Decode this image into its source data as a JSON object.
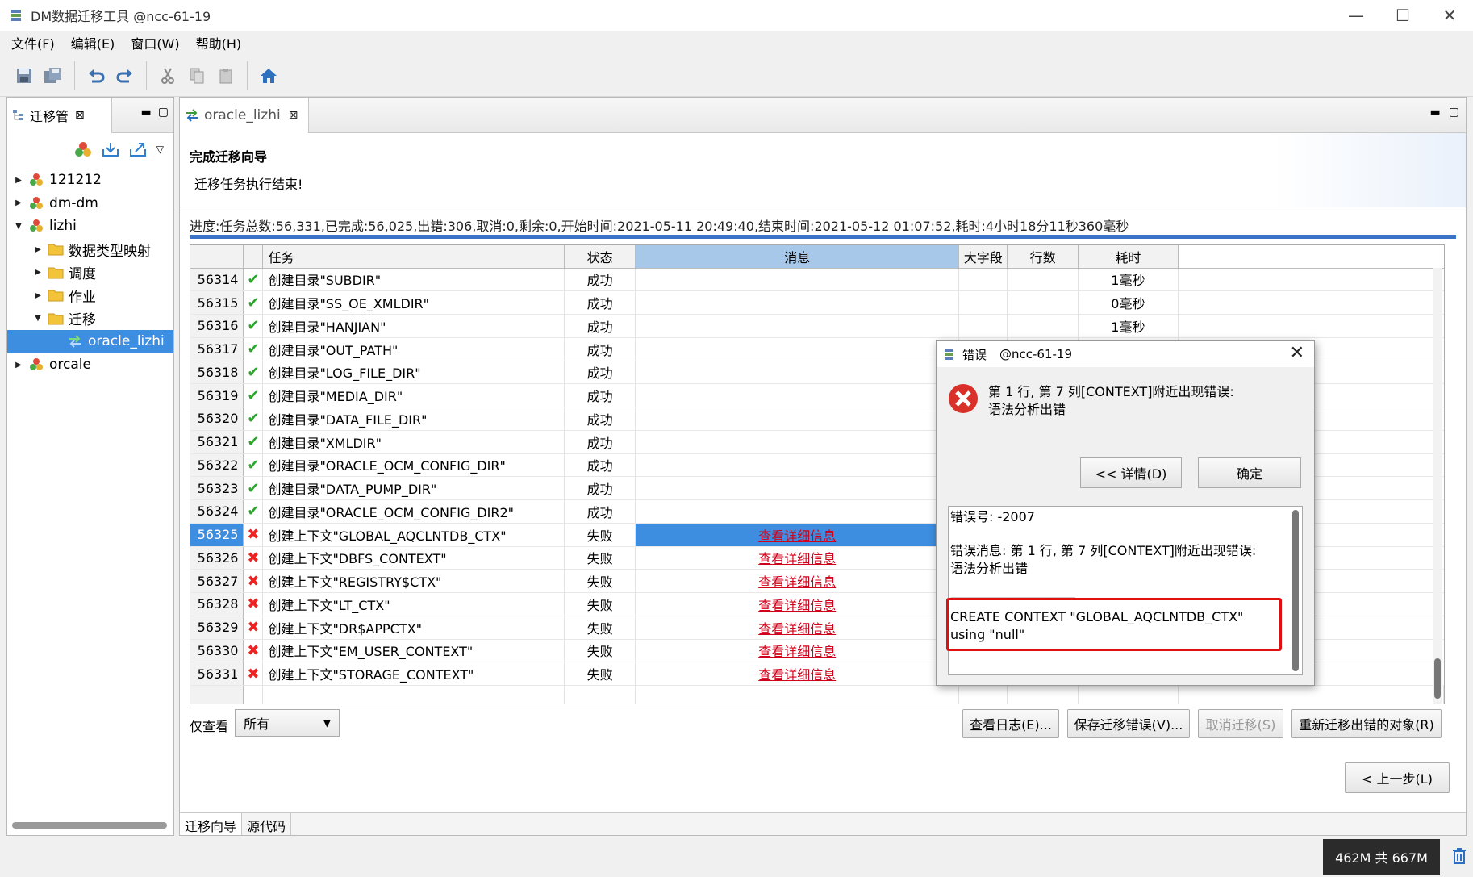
{
  "window": {
    "title": "DM数据迁移工具 @ncc-61-19",
    "minimize": "—",
    "maximize": "☐",
    "close": "✕"
  },
  "menu": [
    "文件(F)",
    "编辑(E)",
    "窗口(W)",
    "帮助(H)"
  ],
  "left_panel": {
    "tab_label": "迁移管",
    "tree": [
      {
        "label": "121212",
        "level": 0,
        "expanded": false,
        "icon": "db-icon"
      },
      {
        "label": "dm-dm",
        "level": 0,
        "expanded": false,
        "icon": "db-icon"
      },
      {
        "label": "lizhi",
        "level": 0,
        "expanded": true,
        "icon": "db-icon"
      },
      {
        "label": "数据类型映射",
        "level": 1,
        "expanded": false,
        "icon": "folder-icon"
      },
      {
        "label": "调度",
        "level": 1,
        "expanded": false,
        "icon": "folder-icon"
      },
      {
        "label": "作业",
        "level": 1,
        "expanded": false,
        "icon": "folder-icon"
      },
      {
        "label": "迁移",
        "level": 1,
        "expanded": true,
        "icon": "folder-open-icon"
      },
      {
        "label": "oracle_lizhi",
        "level": 2,
        "expanded": null,
        "icon": "migrate-icon",
        "selected": true
      },
      {
        "label": "orcale",
        "level": 0,
        "expanded": false,
        "icon": "db-icon"
      }
    ]
  },
  "editor": {
    "tab_label": "oracle_lizhi",
    "wizard_title": "完成迁移向导",
    "wizard_subtitle": "迁移任务执行结束!",
    "progress_text": "进度:任务总数:56,331,已完成:56,025,出错:306,取消:0,剩余:0,开始时间:2021-05-11 20:49:40,结束时间:2021-05-12 01:07:52,耗时:4小时18分11秒360毫秒",
    "columns": [
      "任务",
      "状态",
      "消息",
      "大字段",
      "行数",
      "耗时"
    ],
    "rows": [
      {
        "id": "56314",
        "ok": true,
        "task": "创建目录\"SUBDIR\"",
        "status": "成功",
        "msg": "",
        "time": "1毫秒"
      },
      {
        "id": "56315",
        "ok": true,
        "task": "创建目录\"SS_OE_XMLDIR\"",
        "status": "成功",
        "msg": "",
        "time": "0毫秒"
      },
      {
        "id": "56316",
        "ok": true,
        "task": "创建目录\"HANJIAN\"",
        "status": "成功",
        "msg": "",
        "time": "1毫秒"
      },
      {
        "id": "56317",
        "ok": true,
        "task": "创建目录\"OUT_PATH\"",
        "status": "成功",
        "msg": "",
        "time": ""
      },
      {
        "id": "56318",
        "ok": true,
        "task": "创建目录\"LOG_FILE_DIR\"",
        "status": "成功",
        "msg": "",
        "time": ""
      },
      {
        "id": "56319",
        "ok": true,
        "task": "创建目录\"MEDIA_DIR\"",
        "status": "成功",
        "msg": "",
        "time": ""
      },
      {
        "id": "56320",
        "ok": true,
        "task": "创建目录\"DATA_FILE_DIR\"",
        "status": "成功",
        "msg": "",
        "time": ""
      },
      {
        "id": "56321",
        "ok": true,
        "task": "创建目录\"XMLDIR\"",
        "status": "成功",
        "msg": "",
        "time": ""
      },
      {
        "id": "56322",
        "ok": true,
        "task": "创建目录\"ORACLE_OCM_CONFIG_DIR\"",
        "status": "成功",
        "msg": "",
        "time": ""
      },
      {
        "id": "56323",
        "ok": true,
        "task": "创建目录\"DATA_PUMP_DIR\"",
        "status": "成功",
        "msg": "",
        "time": ""
      },
      {
        "id": "56324",
        "ok": true,
        "task": "创建目录\"ORACLE_OCM_CONFIG_DIR2\"",
        "status": "成功",
        "msg": "",
        "time": ""
      },
      {
        "id": "56325",
        "ok": false,
        "task": "创建上下文\"GLOBAL_AQCLNTDB_CTX\"",
        "status": "失败",
        "msg": "查看详细信息",
        "time": "",
        "selected": true
      },
      {
        "id": "56326",
        "ok": false,
        "task": "创建上下文\"DBFS_CONTEXT\"",
        "status": "失败",
        "msg": "查看详细信息",
        "time": ""
      },
      {
        "id": "56327",
        "ok": false,
        "task": "创建上下文\"REGISTRY$CTX\"",
        "status": "失败",
        "msg": "查看详细信息",
        "time": ""
      },
      {
        "id": "56328",
        "ok": false,
        "task": "创建上下文\"LT_CTX\"",
        "status": "失败",
        "msg": "查看详细信息",
        "time": ""
      },
      {
        "id": "56329",
        "ok": false,
        "task": "创建上下文\"DR$APPCTX\"",
        "status": "失败",
        "msg": "查看详细信息",
        "time": ""
      },
      {
        "id": "56330",
        "ok": false,
        "task": "创建上下文\"EM_USER_CONTEXT\"",
        "status": "失败",
        "msg": "查看详细信息",
        "time": ""
      },
      {
        "id": "56331",
        "ok": false,
        "task": "创建上下文\"STORAGE_CONTEXT\"",
        "status": "失败",
        "msg": "查看详细信息",
        "time": ""
      }
    ],
    "filter_label": "仅查看",
    "filter_value": "所有",
    "btn_view_log": "查看日志(E)...",
    "btn_save_errors": "保存迁移错误(V)...",
    "btn_cancel": "取消迁移(S)",
    "btn_retry": "重新迁移出错的对象(R)",
    "btn_prev": "< 上一步(L)",
    "bottom_tabs": [
      "迁移向导",
      "源代码"
    ]
  },
  "status": {
    "memory": "462M 共 667M"
  },
  "dialog": {
    "title": "错误",
    "host": "@ncc-61-19",
    "message_line1": "第 1 行, 第 7 列[CONTEXT]附近出现错误:",
    "message_line2": "语法分析出错",
    "btn_details": "<< 详情(D)",
    "btn_ok": "确定",
    "detail_code": "错误号:  -2007",
    "detail_msg1": "错误消息: 第 1 行, 第 7 列[CONTEXT]附近出现错误:",
    "detail_msg2": "语法分析出错",
    "detail_sep": "----------------------------------------------------",
    "detail_sql1": "CREATE CONTEXT \"GLOBAL_AQCLNTDB_CTX\"",
    "detail_sql2": "using \"null\""
  },
  "colors": {
    "selection": "#3d8ee0",
    "success": "#2aa52a",
    "error": "#e22222",
    "link": "#d0021b",
    "highlight_box": "#e01010"
  }
}
